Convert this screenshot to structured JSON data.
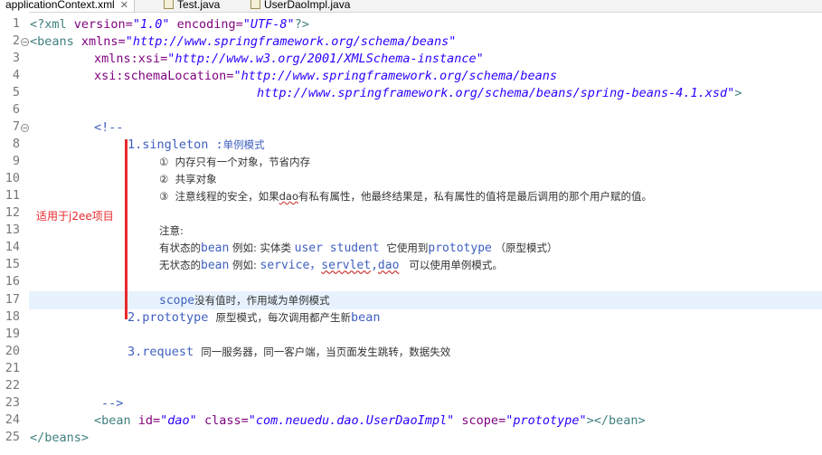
{
  "tabs": [
    {
      "label": "applicationContext.xml",
      "close": "✕"
    },
    {
      "label": "Test.java"
    },
    {
      "label": "UserDaoImpl.java"
    }
  ],
  "lines": [
    "1",
    "2",
    "3",
    "4",
    "5",
    "6",
    "7",
    "8",
    "9",
    "10",
    "11",
    "12",
    "13",
    "14",
    "15",
    "16",
    "17",
    "18",
    "19",
    "20",
    "21",
    "22",
    "23",
    "24",
    "25"
  ],
  "code": {
    "l1": {
      "a": "<?xml ",
      "b": "version=",
      "c": "\"1.0\"",
      "d": " encoding=",
      "e": "\"UTF-8\"",
      "f": "?>"
    },
    "l2": {
      "a": "<beans ",
      "b": "xmlns=",
      "c": "\"http://www.springframework.org/schema/beans\""
    },
    "l3": {
      "b": "xmlns:xsi=",
      "c": "\"http://www.w3.org/2001/XMLSchema-instance\""
    },
    "l4": {
      "b": "xsi:schemaLocation=",
      "c": "\"http://www.springframework.org/schema/beans"
    },
    "l5": {
      "c": "http://www.springframework.org/schema/beans/spring-beans-4.1.xsd\"",
      "f": ">"
    },
    "l7": "<!--",
    "l8": {
      "a": "1.singleton :",
      "b": "单例模式"
    },
    "l9": "①  内存只有一个对象，节省内存",
    "l10": "②  共享对象",
    "l11": {
      "a": "③  注意线程的安全，如果",
      "b": "dao",
      "c": "有私有属性，他最终结果是，私有属性的值将是最后调用的那个用户赋的值。"
    },
    "l13": "注意:",
    "l14": {
      "a": "有状态的",
      "b": "bean",
      "c": " 例如: ",
      "d": "实体类 ",
      "e": "user student ",
      "f": "它使用到",
      "g": "prototype",
      "h": " （原型模式）"
    },
    "l15": {
      "a": "无状态的",
      "b": "bean",
      "c": " 例如: ",
      "d": "service，",
      "e": "servlet",
      "f": ",",
      "g": "dao",
      "h": "   可以使用单例模式。"
    },
    "l17": {
      "a": "scope",
      "b": "没有值时，作用域为单例模式"
    },
    "l18": {
      "a": "2.prototype ",
      "b": "原型模式，每次调用都产生新",
      "c": "bean"
    },
    "l20": {
      "a": "3.request ",
      "b": "同一服务器，同一客户端，当页面发生跳转，数据失效"
    },
    "l23": "-->",
    "l24": {
      "a": "<bean ",
      "b": "id=",
      "c": "\"dao\"",
      "d": " class=",
      "e": "\"com.neuedu.dao.UserDaoImpl\"",
      "f": " scope=",
      "g": "\"prototype\"",
      "h": "></bean>"
    },
    "l25": "</beans>"
  },
  "annotation": "适用于j2ee项目",
  "colors": {
    "tag": "#3f7f7f",
    "attr": "#7f007f",
    "value": "#2a00ff",
    "comment": "#3f5fbf",
    "annotation": "#e8282d",
    "current_line": "#e8f2fe"
  }
}
